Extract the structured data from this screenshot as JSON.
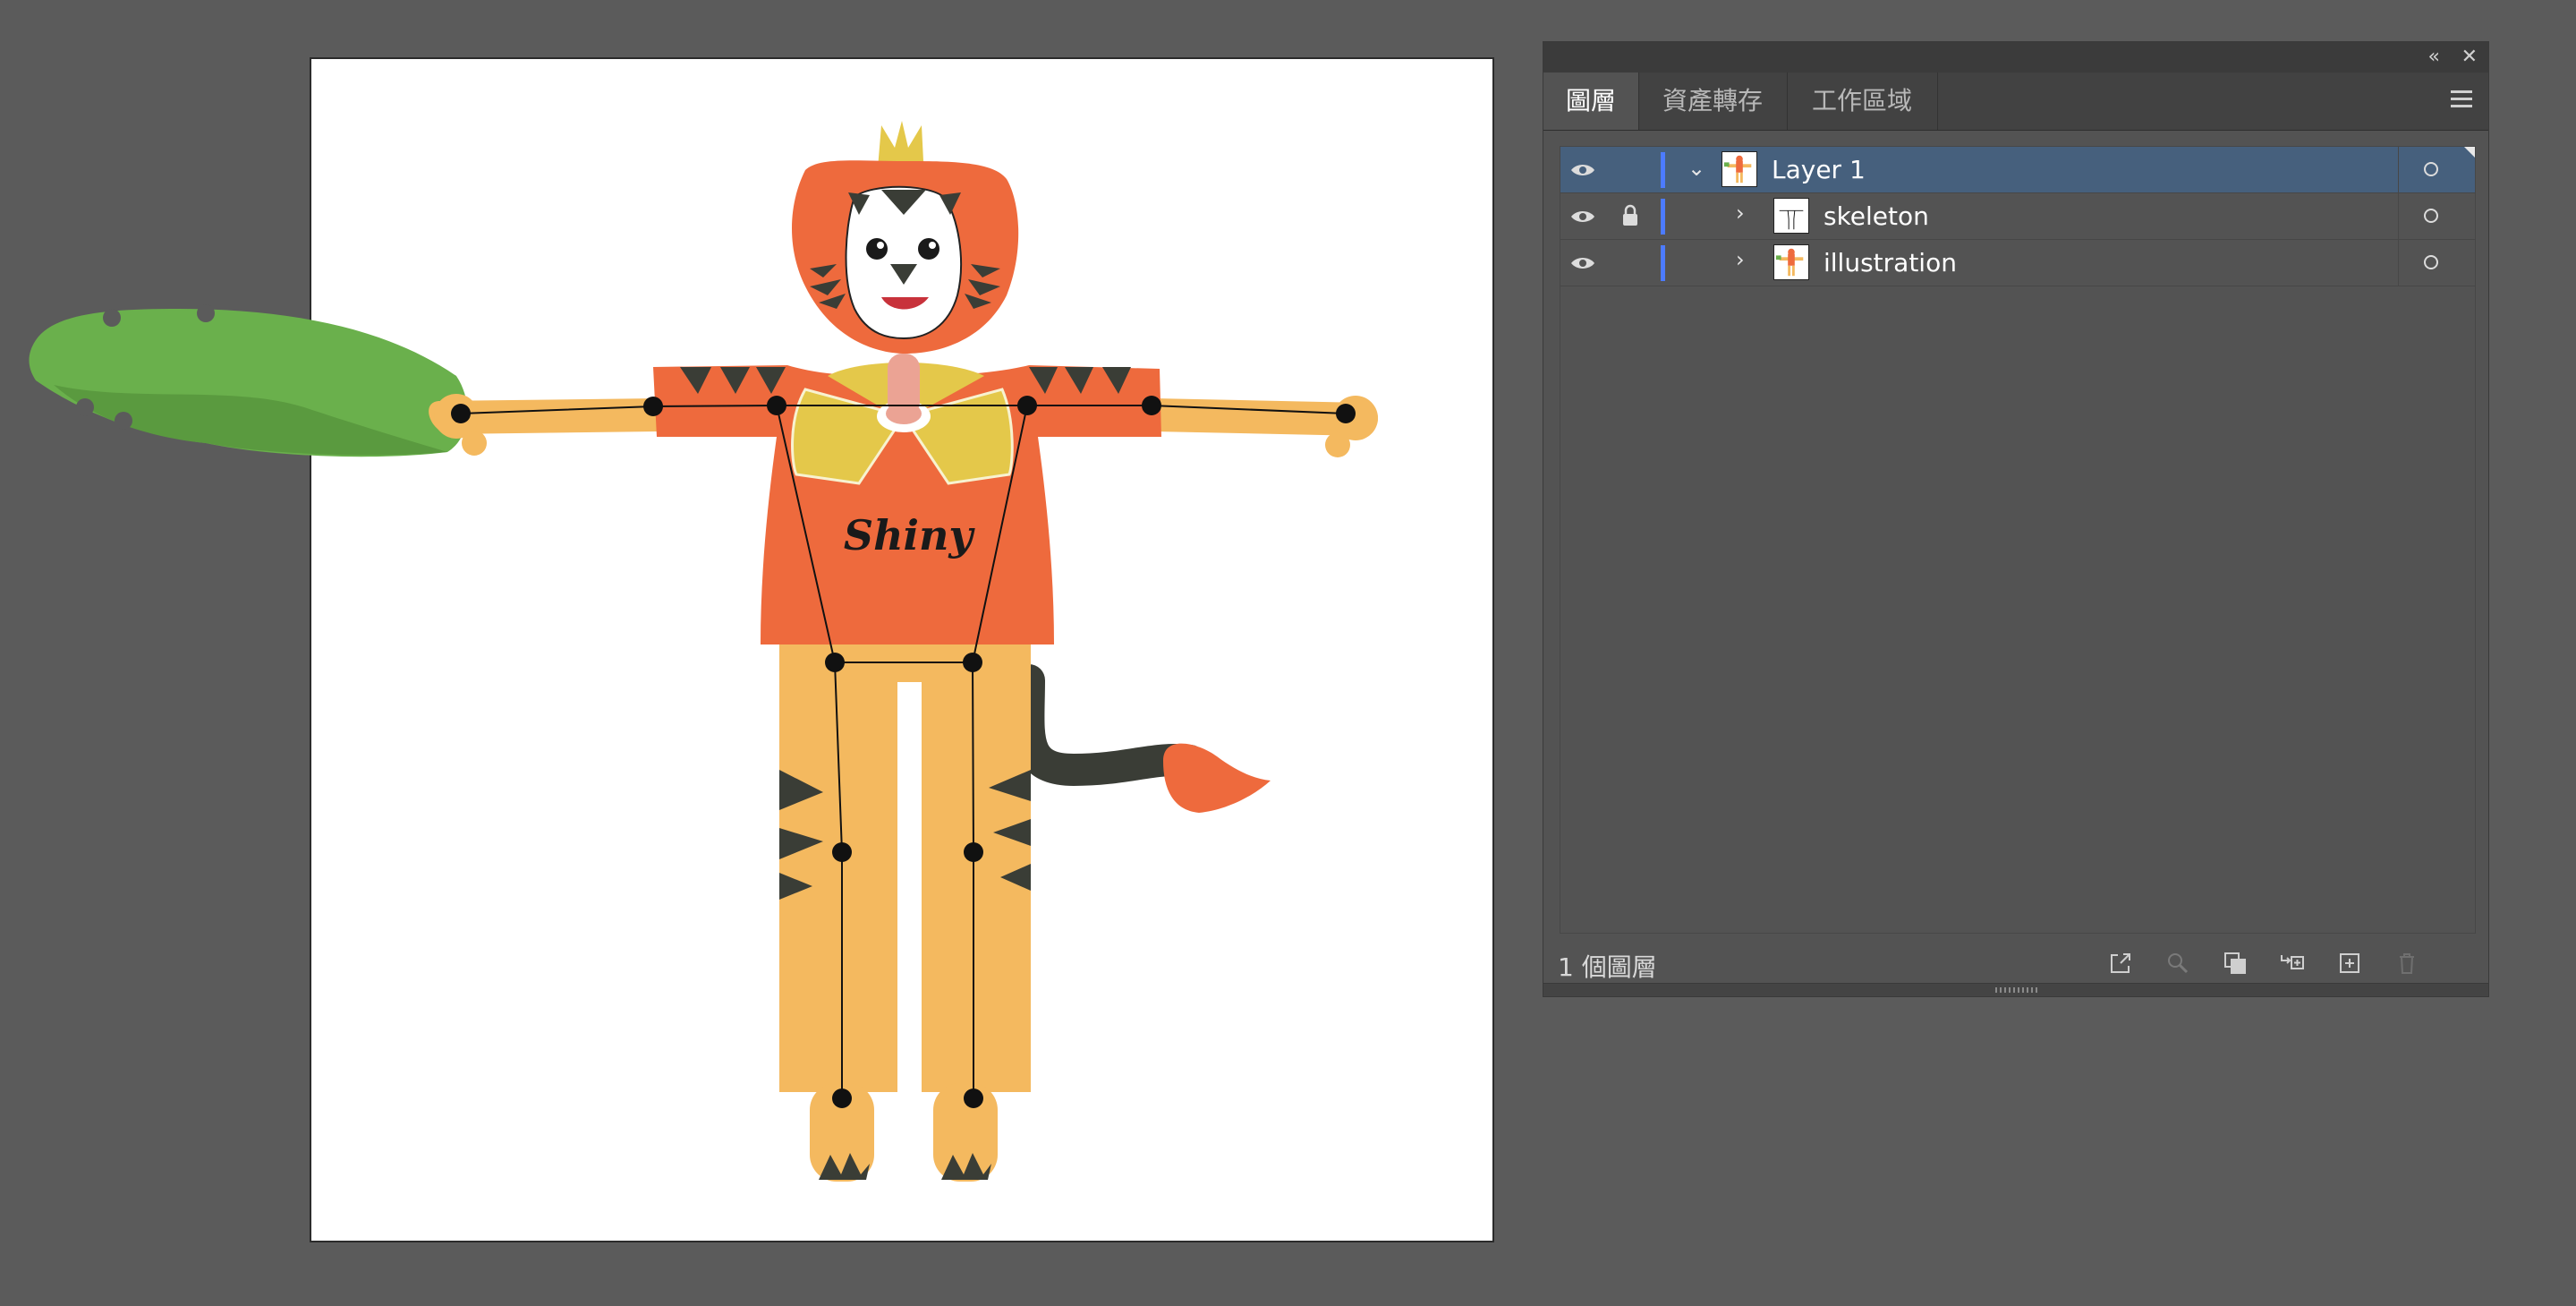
{
  "tabs": [
    {
      "label": "圖層",
      "active": true
    },
    {
      "label": "資產轉存",
      "active": false
    },
    {
      "label": "工作區域",
      "active": false
    }
  ],
  "layers": [
    {
      "name": "Layer 1",
      "expanded": true,
      "selected": true,
      "visible": true,
      "locked": false
    },
    {
      "name": "skeleton",
      "expanded": false,
      "selected": false,
      "visible": true,
      "locked": true
    },
    {
      "name": "illustration",
      "expanded": false,
      "selected": false,
      "visible": true,
      "locked": false
    }
  ],
  "footer": {
    "layer_count": "1 個圖層"
  },
  "artwork": {
    "shirt_text": "Shiny"
  },
  "colors": {
    "selection": "#46607d",
    "layer_color": "#4c7bff",
    "orange": "#ee6a3d",
    "skin": "#f4b95f",
    "yellow": "#e4c84a",
    "leaf": "#6ab04c",
    "dark": "#3a3d36"
  },
  "icons": {
    "visibility": "eye-icon",
    "lock": "lock-icon",
    "expand": "chevron-icon",
    "target": "target-circle-icon",
    "collapse": "double-chevron-left-icon",
    "close": "close-icon",
    "menu": "hamburger-menu-icon",
    "footer": [
      "export-icon",
      "search-icon",
      "clipping-mask-icon",
      "move-to-layer-icon",
      "new-layer-icon",
      "trash-icon"
    ]
  }
}
